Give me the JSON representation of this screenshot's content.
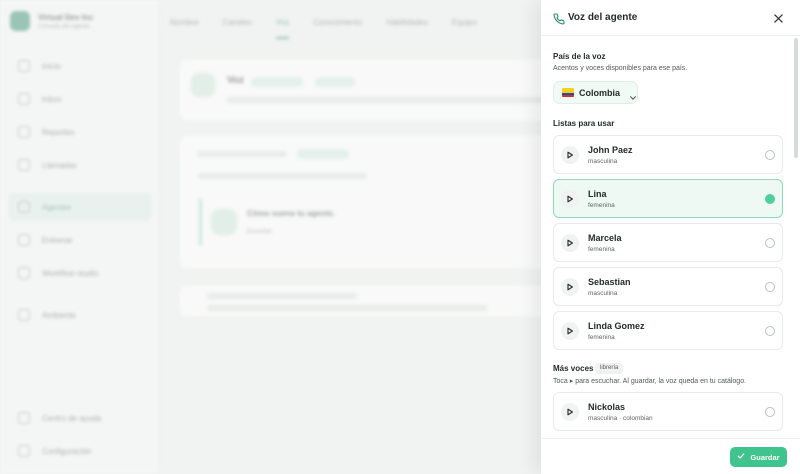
{
  "background": {
    "brand": {
      "title": "Virtual Dev Inc",
      "subtitle": "Consola del agente"
    },
    "nav": [
      "Inicio",
      "Inbox",
      "Reportes",
      "Llamadas",
      "Agentes",
      "Entrenar",
      "Workflow studio",
      "Ambiente"
    ],
    "nav_bottom": [
      "Centro de ayuda",
      "Configuración"
    ],
    "tabs": [
      "Nombre",
      "Canales",
      "Voz",
      "Conocimiento",
      "Habilidades",
      "Equipo"
    ],
    "voice_card_title": "Voz",
    "voice_card_text": "Cómo suena tu agente.",
    "listen_label": "Escuchar"
  },
  "drawer": {
    "title": "Voz del agente",
    "country_section": {
      "title": "País de la voz",
      "subtitle": "Acentos y voces disponibles para ese país.",
      "selected_country": "Colombia"
    },
    "lists_section": {
      "title": "Listas para usar"
    },
    "voices": [
      {
        "name": "John Paez",
        "gender": "masculina",
        "selected": false
      },
      {
        "name": "Lina",
        "gender": "femenina",
        "selected": true
      },
      {
        "name": "Marcela",
        "gender": "femenina",
        "selected": false
      },
      {
        "name": "Sebastian",
        "gender": "masculina",
        "selected": false
      },
      {
        "name": "Linda Gomez",
        "gender": "femenina",
        "selected": false
      }
    ],
    "more_section": {
      "title": "Más voces",
      "badge": "librería",
      "subtitle": "Toca ▸ para escuchar. Al guardar, la voz queda en tu catálogo."
    },
    "more_voices": [
      {
        "name": "Nickolas",
        "gender": "masculina · colombian",
        "selected": false
      }
    ],
    "save_label": "Guardar"
  },
  "colors": {
    "accent": "#3fc48e",
    "selected_border": "#8fd9bf",
    "selected_bg": "#eef9f4"
  }
}
